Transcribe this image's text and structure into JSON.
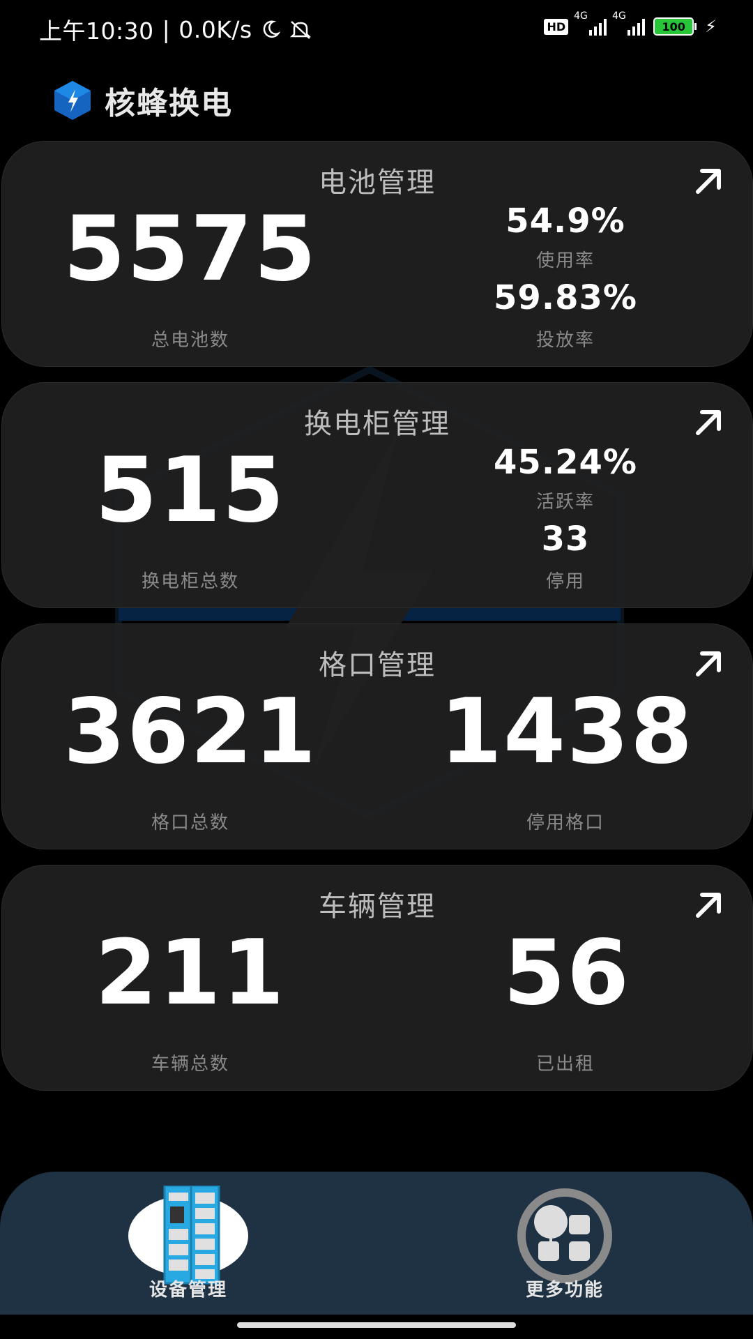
{
  "status_bar": {
    "time": "上午10:30",
    "network_speed": "0.0K/s",
    "hd_badge": "HD",
    "signal_1_label": "4G",
    "signal_2_label": "4G",
    "battery": "100",
    "icons": [
      "moon-icon",
      "mute-icon",
      "signal-icon",
      "battery-icon",
      "charging-icon"
    ]
  },
  "header": {
    "app_name": "核蜂换电",
    "logo_icon": "lightning-hexagon-icon"
  },
  "cards": {
    "battery": {
      "title": "电池管理",
      "total_value": "5575",
      "total_label": "总电池数",
      "usage_rate_value": "54.9%",
      "usage_rate_label": "使用率",
      "deploy_rate_value": "59.83%",
      "deploy_rate_label": "投放率"
    },
    "cabinet": {
      "title": "换电柜管理",
      "total_value": "515",
      "total_label": "换电柜总数",
      "active_rate_value": "45.24%",
      "active_rate_label": "活跃率",
      "disabled_value": "33",
      "disabled_label": "停用"
    },
    "slot": {
      "title": "格口管理",
      "total_value": "3621",
      "total_label": "格口总数",
      "disabled_value": "1438",
      "disabled_label": "停用格口"
    },
    "vehicle": {
      "title": "车辆管理",
      "total_value": "211",
      "total_label": "车辆总数",
      "rented_value": "56",
      "rented_label": "已出租"
    }
  },
  "bottom_nav": {
    "device_management": "设备管理",
    "more_functions": "更多功能"
  },
  "colors": {
    "background": "#000000",
    "card": "#202020",
    "nav": "#1e3243",
    "accent_blue": "#1565c0",
    "battery_green": "#27c537"
  }
}
